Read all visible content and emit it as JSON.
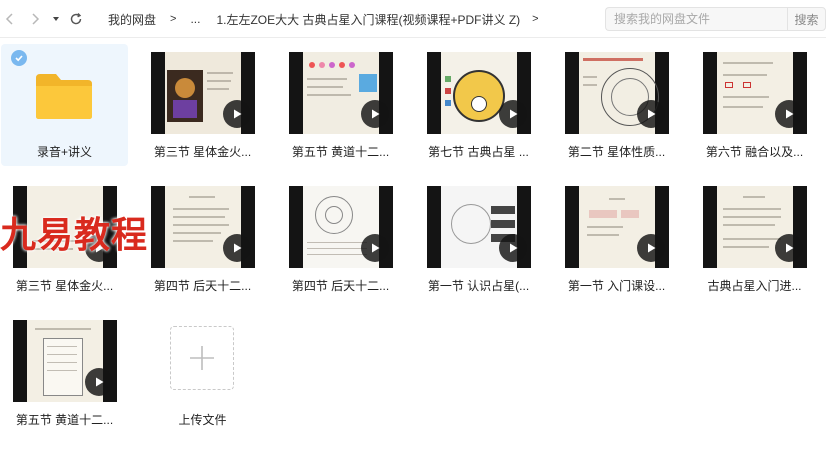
{
  "nav": {
    "back_icon": "chevron-left-icon",
    "forward_icon": "chevron-right-icon",
    "dropdown_icon": "caret-down-icon",
    "refresh_icon": "refresh-icon"
  },
  "breadcrumb": {
    "root": "我的网盘",
    "sep1": ">",
    "ellipsis": "...",
    "sep2": ">",
    "current": "1.左左ZOE大大 古典占星入门课程(视频课程+PDF讲义 Z)",
    "sep3": ">"
  },
  "search": {
    "placeholder": "搜索我的网盘文件",
    "button": "搜索"
  },
  "watermark": "九易教程",
  "files": [
    {
      "label": "录音+讲义",
      "type": "folder",
      "selected": true
    },
    {
      "label": "第三节 星体金火...",
      "type": "video"
    },
    {
      "label": "第五节 黄道十二...",
      "type": "video"
    },
    {
      "label": "第七节 古典占星 ...",
      "type": "video"
    },
    {
      "label": "第二节 星体性质...",
      "type": "video"
    },
    {
      "label": "第六节 融合以及...",
      "type": "video"
    },
    {
      "label": "第三节 星体金火...",
      "type": "video"
    },
    {
      "label": "第四节 后天十二...",
      "type": "video"
    },
    {
      "label": "第四节 后天十二...",
      "type": "video"
    },
    {
      "label": "第一节 认识占星(...",
      "type": "video"
    },
    {
      "label": "第一节 入门课设...",
      "type": "video"
    },
    {
      "label": "古典占星入门进...",
      "type": "video"
    },
    {
      "label": "第五节 黄道十二...",
      "type": "video"
    },
    {
      "label": "上传文件",
      "type": "upload"
    }
  ],
  "colors": {
    "folder": "#fcc83b",
    "selected_bg": "#eef6fd",
    "check": "#7ab8ef",
    "watermark": "#d92a1e"
  }
}
